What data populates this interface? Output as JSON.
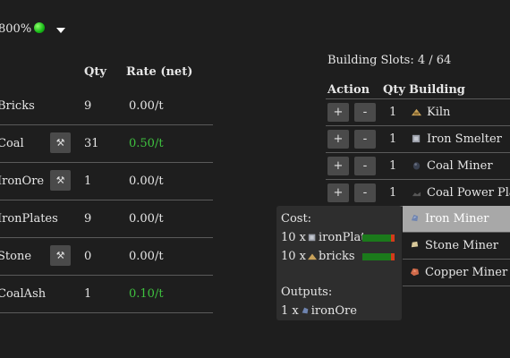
{
  "topbar": {
    "speed": "800%",
    "status_color": "#22cc22"
  },
  "resources": {
    "headers": {
      "qty": "Qty",
      "rate": "Rate (net)"
    },
    "rows": [
      {
        "name": "Bricks",
        "qty": "9",
        "rate": "0.00/t",
        "has_mine": false,
        "positive": false
      },
      {
        "name": "Coal",
        "qty": "31",
        "rate": "0.50/t",
        "has_mine": true,
        "positive": true
      },
      {
        "name": "IronOre",
        "qty": "1",
        "rate": "0.00/t",
        "has_mine": true,
        "positive": false
      },
      {
        "name": "IronPlates",
        "qty": "9",
        "rate": "0.00/t",
        "has_mine": false,
        "positive": false
      },
      {
        "name": "Stone",
        "qty": "0",
        "rate": "0.00/t",
        "has_mine": true,
        "positive": false
      },
      {
        "name": "CoalAsh",
        "qty": "1",
        "rate": "0.10/t",
        "has_mine": false,
        "positive": true
      }
    ],
    "mine_icon": "pickaxe-icon"
  },
  "buildings": {
    "slots_label": "Building Slots: 4 / 64",
    "headers": {
      "action": "Action",
      "qty": "Qty",
      "building": "Building"
    },
    "plus_label": "+",
    "minus_label": "-",
    "owned": [
      {
        "qty": "1",
        "name": "Kiln",
        "icon": "kiln-icon"
      },
      {
        "qty": "1",
        "name": "Iron Smelter",
        "icon": "iron-smelter-icon"
      },
      {
        "qty": "1",
        "name": "Coal Miner",
        "icon": "coal-miner-icon"
      },
      {
        "qty": "1",
        "name": "Coal Power Plant",
        "icon": "coal-power-plant-icon"
      }
    ],
    "available": [
      {
        "name": "Iron Miner",
        "icon": "iron-miner-icon",
        "selected": true
      },
      {
        "name": "Stone Miner",
        "icon": "stone-miner-icon",
        "selected": false
      },
      {
        "name": "Copper Miner",
        "icon": "copper-miner-icon",
        "selected": false
      }
    ]
  },
  "tooltip": {
    "cost_label": "Cost:",
    "costs": [
      {
        "qty": "10 x",
        "name": "ironPlates",
        "icon": "iron-plate-icon",
        "fill": 0.9
      },
      {
        "qty": "10 x",
        "name": "bricks",
        "icon": "brick-icon",
        "fill": 0.9
      }
    ],
    "outputs_label": "Outputs:",
    "outputs": [
      {
        "qty": "1 x",
        "name": "ironOre",
        "icon": "iron-ore-icon"
      }
    ]
  }
}
